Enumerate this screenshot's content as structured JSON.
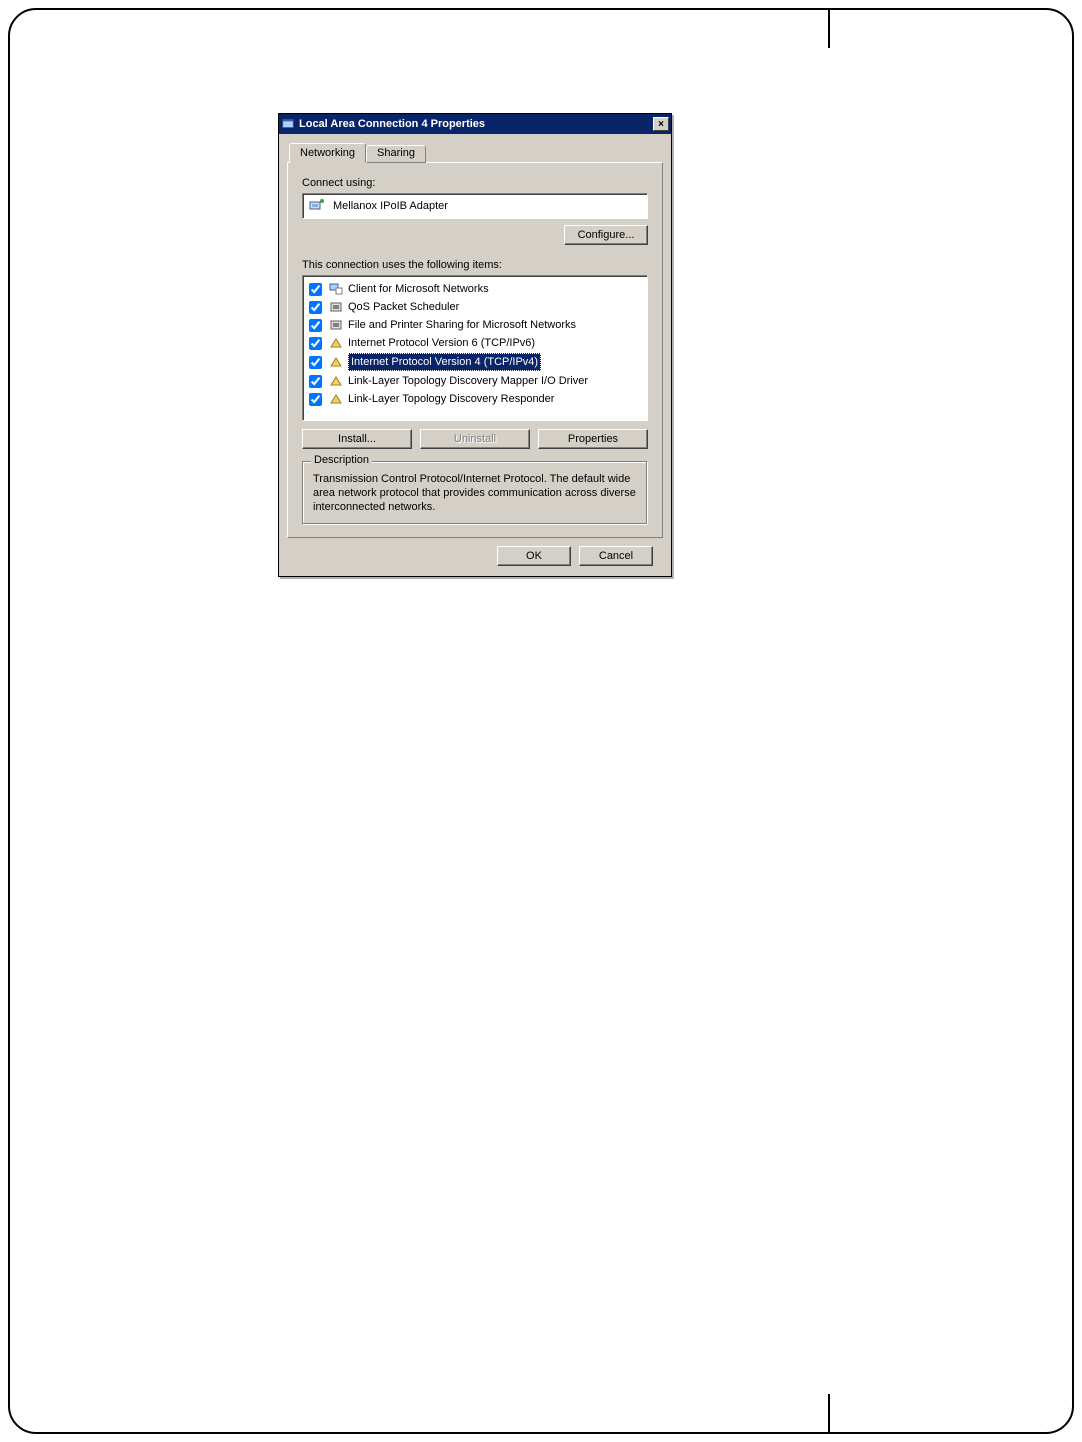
{
  "window": {
    "title": "Local Area Connection 4 Properties",
    "close_icon": "×"
  },
  "tabs": [
    {
      "label": "Networking",
      "active": true
    },
    {
      "label": "Sharing",
      "active": false
    }
  ],
  "connect_using_label": "Connect using:",
  "adapter_name": "Mellanox IPoIB Adapter",
  "configure_button": "Configure...",
  "items_label": "This connection uses the following items:",
  "items": [
    {
      "checked": true,
      "icon": "client-icon",
      "label": "Client for Microsoft Networks",
      "selected": false
    },
    {
      "checked": true,
      "icon": "service-icon",
      "label": "QoS Packet Scheduler",
      "selected": false
    },
    {
      "checked": true,
      "icon": "service-icon",
      "label": "File and Printer Sharing for Microsoft Networks",
      "selected": false
    },
    {
      "checked": true,
      "icon": "protocol-icon",
      "label": "Internet Protocol Version 6 (TCP/IPv6)",
      "selected": false
    },
    {
      "checked": true,
      "icon": "protocol-icon",
      "label": "Internet Protocol Version 4 (TCP/IPv4)",
      "selected": true
    },
    {
      "checked": true,
      "icon": "protocol-icon",
      "label": "Link-Layer Topology Discovery Mapper I/O Driver",
      "selected": false
    },
    {
      "checked": true,
      "icon": "protocol-icon",
      "label": "Link-Layer Topology Discovery Responder",
      "selected": false
    }
  ],
  "buttons": {
    "install": "Install...",
    "uninstall": "Uninstall",
    "properties": "Properties"
  },
  "description": {
    "title": "Description",
    "text": "Transmission Control Protocol/Internet Protocol. The default wide area network protocol that provides communication across diverse interconnected networks."
  },
  "footer": {
    "ok": "OK",
    "cancel": "Cancel"
  }
}
